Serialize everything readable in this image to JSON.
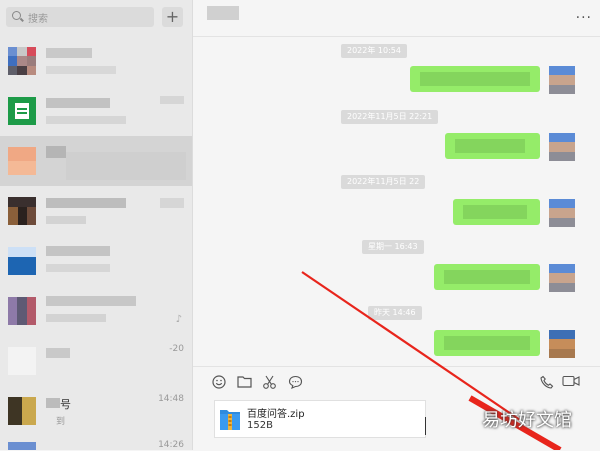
{
  "search": {
    "placeholder": "搜索"
  },
  "add_button": {
    "label": "+"
  },
  "sessions": [
    {
      "time": "",
      "name": "",
      "preview": ""
    },
    {
      "time": "",
      "name": "",
      "preview": ""
    },
    {
      "time": "",
      "name": "",
      "preview": ""
    },
    {
      "time": "",
      "name": "",
      "preview": ""
    },
    {
      "time": "",
      "name": "",
      "preview": ""
    },
    {
      "time": "",
      "name": "",
      "preview": ""
    },
    {
      "time": "-20",
      "name": "",
      "preview": ""
    },
    {
      "time": "14:48",
      "name": "号",
      "preview": "到"
    },
    {
      "time": "14:26",
      "name": "",
      "preview": ""
    }
  ],
  "chat": {
    "more_label": "···",
    "timestamps": [
      "2022年   10:54",
      "2022年11月5日 22:21",
      "2022年11月5日 22",
      "星期一 16:43",
      "昨天 14:46"
    ]
  },
  "toolbar": {
    "emoji_icon": "emoji-icon",
    "folder_icon": "folder-icon",
    "scissors_icon": "scissors-icon",
    "chat_icon": "chat-bubble-icon",
    "phone_icon": "phone-icon",
    "video_icon": "video-icon"
  },
  "attachment": {
    "name": "百度问答.zip",
    "size": "152B"
  },
  "watermark": "易坊好文馆",
  "colors": {
    "bubble_green": "#95ec69",
    "arrow_red": "#e8251c"
  }
}
